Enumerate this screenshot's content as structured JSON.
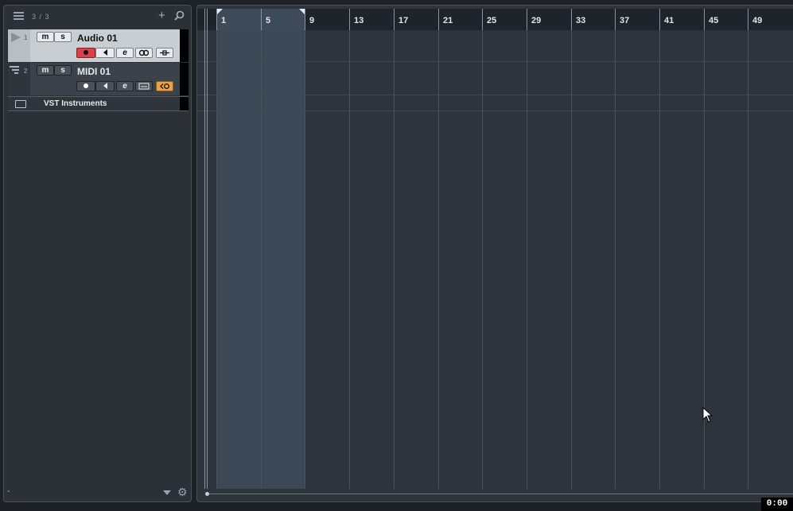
{
  "tracklist": {
    "count": "3 / 3",
    "add_label": "+",
    "tracks": [
      {
        "number": "1",
        "name": "Audio 01",
        "mute": "m",
        "solo": "s",
        "edit": "e"
      },
      {
        "number": "2",
        "name": "MIDI 01",
        "mute": "m",
        "solo": "s",
        "edit": "e"
      }
    ],
    "folder": {
      "name": "VST Instruments"
    },
    "bottom_left": "-"
  },
  "ruler": {
    "bars": [
      "1",
      "5",
      "9",
      "13",
      "17",
      "21",
      "25",
      "29",
      "33",
      "37",
      "41",
      "45",
      "49"
    ]
  },
  "timer": "0:00",
  "colors": {
    "record_active": "#d6414a",
    "midi_input": "#e8a34e",
    "cycle_region": "#3c4856"
  }
}
